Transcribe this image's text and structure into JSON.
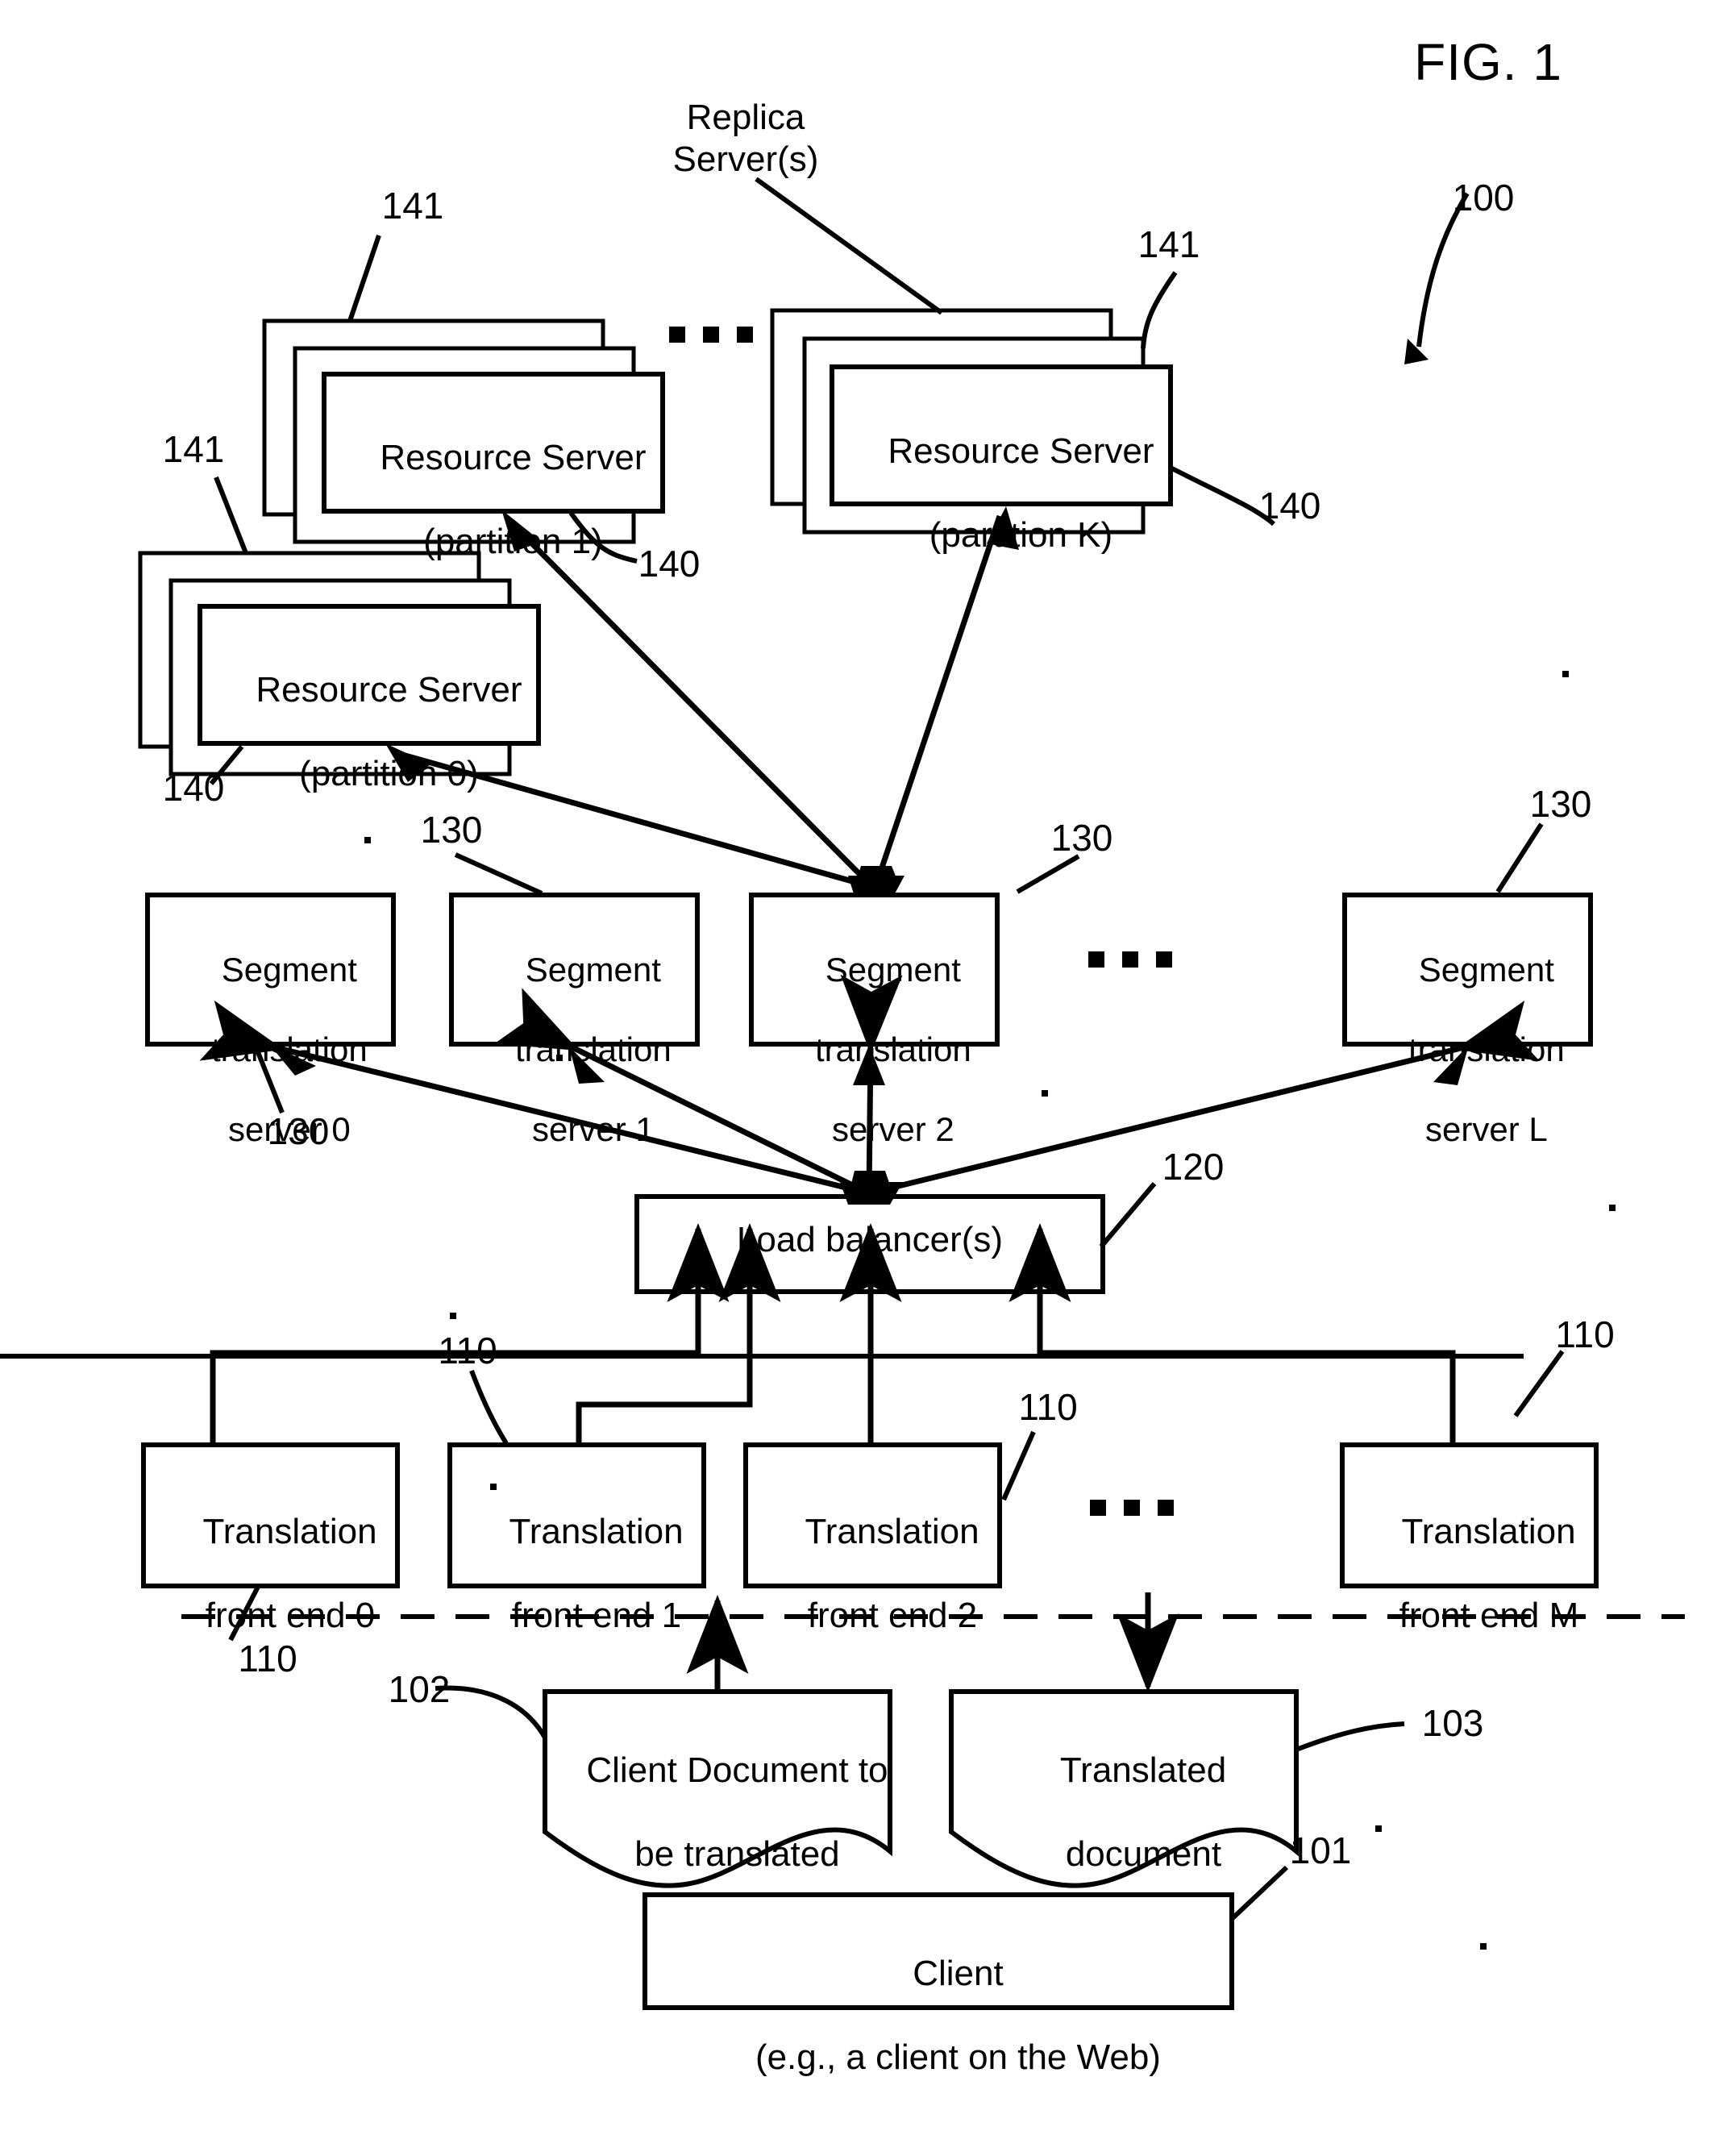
{
  "figure": {
    "title": "FIG. 1",
    "system_ref": "100"
  },
  "annotations": {
    "replica_servers_label": "Replica\nServer(s)",
    "ref_141_a": "141",
    "ref_141_b": "141",
    "ref_141_c": "141",
    "ref_140_a": "140",
    "ref_140_b": "140",
    "ref_140_c": "140",
    "ref_130_a": "130",
    "ref_130_b": "130",
    "ref_130_c": "130",
    "ref_130_d": "130",
    "ref_120": "120",
    "ref_110_a": "110",
    "ref_110_b": "110",
    "ref_110_c": "110",
    "ref_110_d": "110",
    "ref_102": "102",
    "ref_103": "103",
    "ref_101": "101"
  },
  "resource_servers": [
    {
      "id": "rs-partition-1",
      "line1": "Resource Server",
      "line2": "(partition 1)"
    },
    {
      "id": "rs-partition-k",
      "line1": "Resource Server",
      "line2": "(partition K)"
    },
    {
      "id": "rs-partition-0",
      "line1": "Resource Server",
      "line2": "(partition 0)"
    }
  ],
  "segment_translation_servers": [
    {
      "id": "sts-0",
      "line1": "Segment",
      "line2": "translation",
      "line3": "server 0"
    },
    {
      "id": "sts-1",
      "line1": "Segment",
      "line2": "translation",
      "line3": "server 1"
    },
    {
      "id": "sts-2",
      "line1": "Segment",
      "line2": "translation",
      "line3": "server 2"
    },
    {
      "id": "sts-l",
      "line1": "Segment",
      "line2": "translation",
      "line3": "server L"
    }
  ],
  "load_balancer": {
    "label": "Load balancer(s)"
  },
  "translation_front_ends": [
    {
      "id": "tfe-0",
      "line1": "Translation",
      "line2": "front end 0"
    },
    {
      "id": "tfe-1",
      "line1": "Translation",
      "line2": "front end 1"
    },
    {
      "id": "tfe-2",
      "line1": "Translation",
      "line2": "front end 2"
    },
    {
      "id": "tfe-m",
      "line1": "Translation",
      "line2": "front end M"
    }
  ],
  "documents": {
    "input": {
      "line1": "Client Document to",
      "line2": "be translated"
    },
    "output": {
      "line1": "Translated",
      "line2": "document"
    }
  },
  "client": {
    "line1": "Client",
    "line2": "(e.g., a client on the Web)"
  },
  "colors": {
    "stroke": "#000000",
    "background": "#ffffff"
  }
}
